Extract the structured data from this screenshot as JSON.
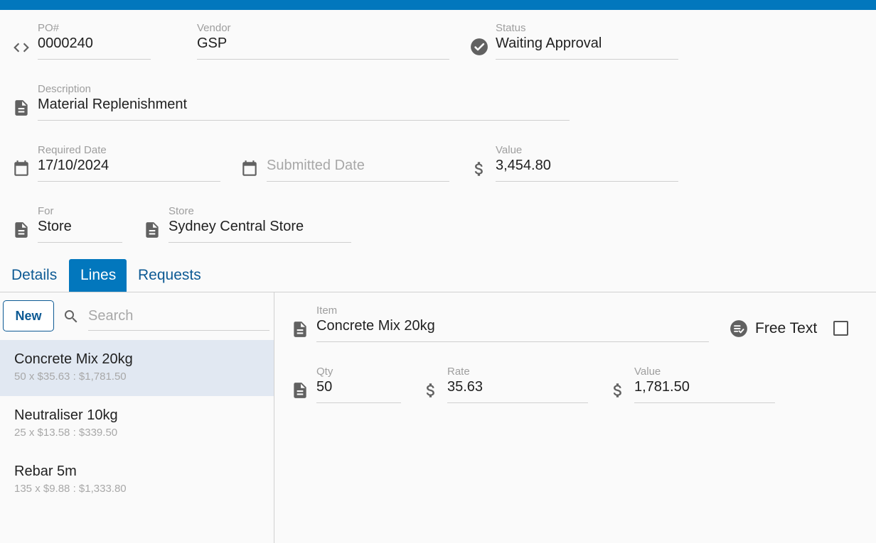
{
  "header": {
    "po": {
      "label": "PO#",
      "value": "0000240",
      "icon": "code-icon"
    },
    "vendor": {
      "label": "Vendor",
      "value": "GSP"
    },
    "status": {
      "label": "Status",
      "value": "Waiting Approval",
      "icon": "check-circle-icon"
    },
    "description": {
      "label": "Description",
      "value": "Material Replenishment",
      "icon": "document-icon"
    },
    "required_date": {
      "label": "Required Date",
      "value": "17/10/2024",
      "icon": "calendar-icon"
    },
    "submitted_date": {
      "placeholder": "Submitted Date",
      "icon": "calendar-icon"
    },
    "value": {
      "label": "Value",
      "value": "3,454.80",
      "icon": "dollar-icon"
    },
    "for": {
      "label": "For",
      "value": "Store",
      "icon": "document-icon"
    },
    "store": {
      "label": "Store",
      "value": "Sydney Central Store",
      "icon": "document-icon"
    }
  },
  "tabs": [
    {
      "label": "Details",
      "active": false
    },
    {
      "label": "Lines",
      "active": true
    },
    {
      "label": "Requests",
      "active": false
    }
  ],
  "lines": {
    "new_label": "New",
    "search_placeholder": "Search",
    "items": [
      {
        "title": "Concrete Mix 20kg",
        "subtitle": "50 x $35.63 : $1,781.50",
        "selected": true
      },
      {
        "title": "Neutraliser 10kg",
        "subtitle": "25 x $13.58 : $339.50",
        "selected": false
      },
      {
        "title": "Rebar 5m",
        "subtitle": "135 x $9.88 : $1,333.80",
        "selected": false
      }
    ]
  },
  "detail": {
    "item": {
      "label": "Item",
      "value": "Concrete Mix 20kg",
      "icon": "document-icon"
    },
    "free_text": {
      "label": "Free Text",
      "checked": false,
      "icon": "rule-circle-icon"
    },
    "qty": {
      "label": "Qty",
      "value": "50",
      "icon": "document-icon"
    },
    "rate": {
      "label": "Rate",
      "value": "35.63",
      "icon": "dollar-icon"
    },
    "value": {
      "label": "Value",
      "value": "1,781.50",
      "icon": "dollar-icon"
    }
  },
  "colors": {
    "accent": "#0277bd",
    "link": "#0d5a94",
    "selected_row": "#e1e8f2",
    "icon": "#616161"
  }
}
